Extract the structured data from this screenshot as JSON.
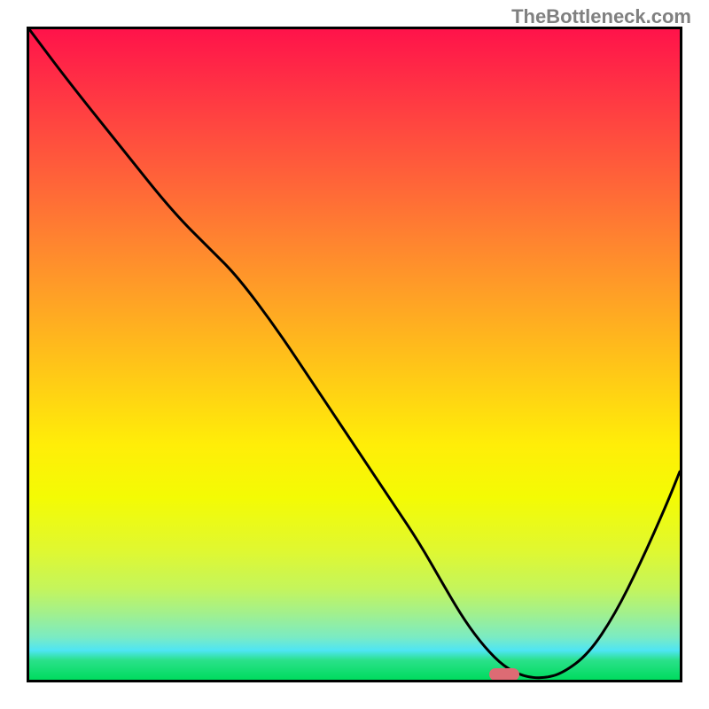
{
  "watermark": "TheBottleneck.com",
  "chart_data": {
    "type": "line",
    "title": "",
    "xlabel": "",
    "ylabel": "",
    "xlim": [
      0,
      100
    ],
    "ylim": [
      0,
      100
    ],
    "series": [
      {
        "name": "curve",
        "x": [
          0,
          6,
          14,
          22,
          28,
          32,
          38,
          44,
          50,
          56,
          60,
          64,
          67,
          70,
          73,
          76,
          79,
          82,
          86,
          90,
          94,
          98,
          100
        ],
        "y": [
          100,
          92,
          82,
          72,
          66,
          62,
          54,
          45,
          36,
          27,
          21,
          14,
          9,
          5,
          2,
          0.5,
          0.2,
          1,
          4,
          10,
          18,
          27,
          32
        ]
      }
    ],
    "marker": {
      "x": 73,
      "y": 0.8
    },
    "background_gradient": {
      "orientation": "vertical",
      "stops": [
        {
          "pos": 0.0,
          "color": "#ff134a"
        },
        {
          "pos": 0.5,
          "color": "#ffb81d"
        },
        {
          "pos": 0.7,
          "color": "#ffee08"
        },
        {
          "pos": 0.9,
          "color": "#a0f090"
        },
        {
          "pos": 1.0,
          "color": "#00db5e"
        }
      ]
    }
  }
}
